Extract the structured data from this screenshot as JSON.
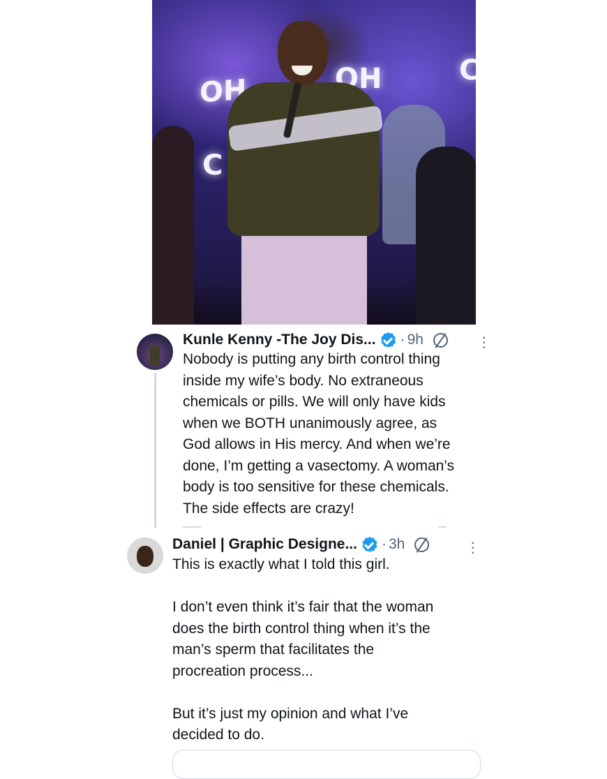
{
  "photo": {
    "stage_text": [
      "OH",
      "OH",
      "C",
      "C"
    ]
  },
  "tweets": [
    {
      "author": "Kunle Kenny -The Joy Dis...",
      "verified": true,
      "separator": "·",
      "time": "9h",
      "text": "Nobody is putting any birth control thing\ninside my wife’s body. No extraneous\nchemicals or pills. We will only have kids\nwhen we BOTH unanimously agree, as\nGod allows in His mercy. And when we’re\ndone, I’m getting a vasectomy. A woman’s\nbody is too sensitive for these chemicals.\nThe side effects are crazy!"
    },
    {
      "author": "Daniel | Graphic Designe...",
      "verified": true,
      "separator": "·",
      "time": "3h",
      "text": "This is exactly what I told this girl.\n\nI don’t even think it’s fair that the woman\ndoes the birth control thing when it’s the\nman’s sperm that facilitates the\nprocreation process...\n\nBut it’s just my opinion and what I’ve\ndecided to do."
    }
  ],
  "colors": {
    "verified_blue": "#1d9bf0",
    "meta_gray": "#536471",
    "text_black": "#0f1419",
    "thread_line": "#cfd9de"
  },
  "icons": [
    "verified-badge-icon",
    "grok-icon",
    "more-options-icon"
  ]
}
